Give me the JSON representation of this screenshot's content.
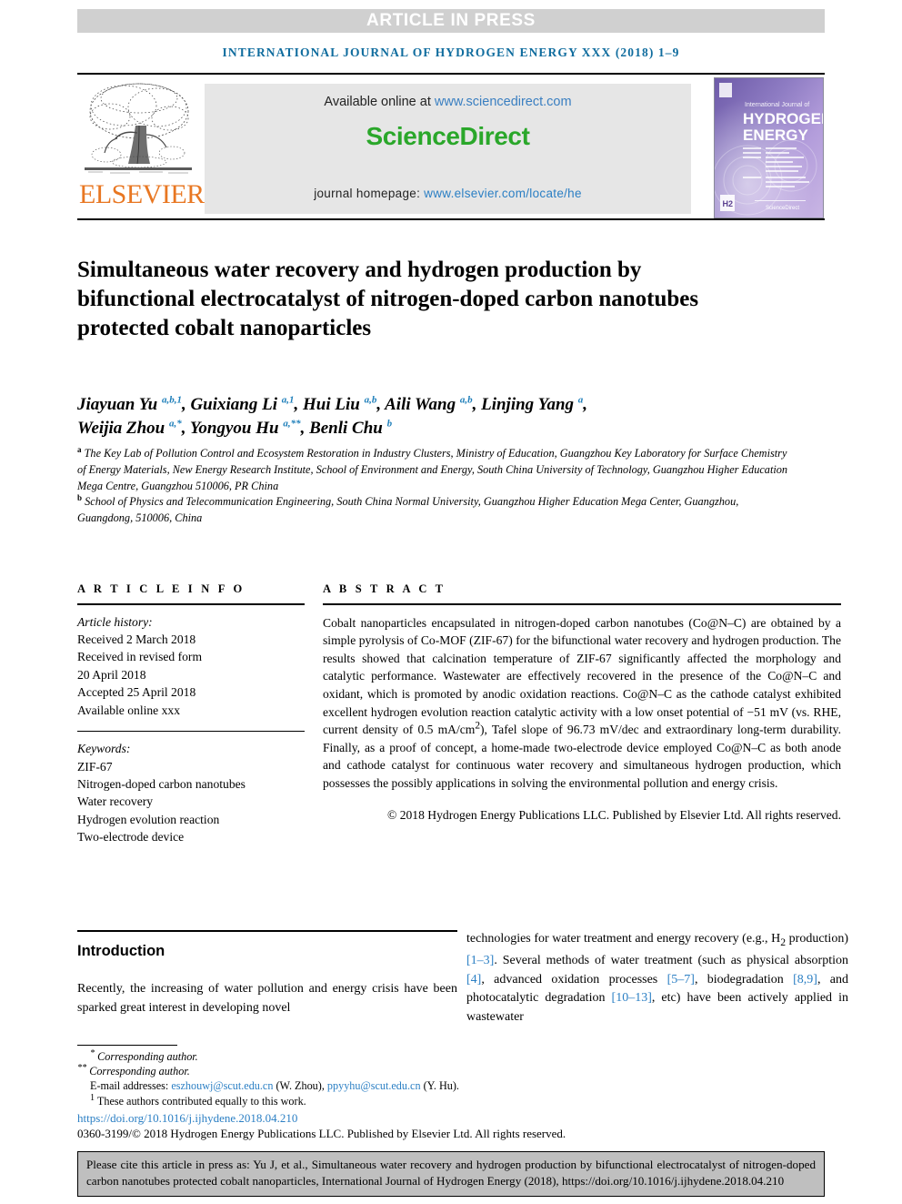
{
  "banner": {
    "text": "ARTICLE IN PRESS"
  },
  "running_head": {
    "text": "INTERNATIONAL JOURNAL OF HYDROGEN ENERGY XXX (2018) 1–9"
  },
  "masthead": {
    "publisher": "ELSEVIER",
    "available_prefix": "Available online at ",
    "available_url": "www.sciencedirect.com",
    "sciencedirect_logo": "ScienceDirect",
    "homepage_prefix": "journal homepage: ",
    "homepage_url": "www.elsevier.com/locate/he",
    "cover": {
      "kicker": "International Journal of",
      "line1": "HYDROGEN",
      "line2": "ENERGY",
      "footer": "ScienceDirect",
      "badge": "H2"
    }
  },
  "article": {
    "title": "Simultaneous water recovery and hydrogen production by bifunctional electrocatalyst of nitrogen-doped carbon nanotubes protected cobalt nanoparticles",
    "authors_line1_html": "Jiayuan Yu <sup>a,b,1</sup>, Guixiang Li <sup>a,1</sup>, Hui Liu <sup>a,b</sup>, Aili Wang <sup>a,b</sup>, Linjing Yang <sup>a</sup>,",
    "authors_line2_html": "Weijia Zhou <sup>a,*</sup>, Yongyou Hu <sup>a,**</sup>, Benli Chu <sup>b</sup>",
    "affiliation_a": "The Key Lab of Pollution Control and Ecosystem Restoration in Industry Clusters, Ministry of Education, Guangzhou Key Laboratory for Surface Chemistry of Energy Materials, New Energy Research Institute, School of Environment and Energy, South China University of Technology, Guangzhou Higher Education Mega Centre, Guangzhou 510006, PR China",
    "affiliation_b": "School of Physics and Telecommunication Engineering, South China Normal University, Guangzhou Higher Education Mega Center, Guangzhou, Guangdong, 510006, China"
  },
  "article_info": {
    "heading": "A R T I C L E   I N F O",
    "history_label": "Article history:",
    "history": [
      "Received 2 March 2018",
      "Received in revised form",
      "20 April 2018",
      "Accepted 25 April 2018",
      "Available online xxx"
    ],
    "keywords_label": "Keywords:",
    "keywords": [
      "ZIF-67",
      "Nitrogen-doped carbon nanotubes",
      "Water recovery",
      "Hydrogen evolution reaction",
      "Two-electrode device"
    ]
  },
  "abstract": {
    "heading": "A B S T R A C T",
    "body_html": "Cobalt nanoparticles encapsulated in nitrogen-doped carbon nanotubes (Co@N&ndash;C) are obtained by a simple pyrolysis of Co-MOF (ZIF-67) for the bifunctional water recovery and hydrogen production. The results showed that calcination temperature of ZIF-67 significantly affected the morphology and catalytic performance. Wastewater are effectively recovered in the presence of the Co@N&ndash;C and oxidant, which is promoted by anodic oxidation reactions. Co@N&ndash;C as the cathode catalyst exhibited excellent hydrogen evolution reaction catalytic activity with a low onset potential of &minus;51&nbsp;mV (vs. RHE, current density of 0.5&nbsp;mA/cm<sup>2</sup>), Tafel slope of 96.73&nbsp;mV/dec and extraordinary long-term durability. Finally, as a proof of concept, a home-made two-electrode device employed Co@N&ndash;C as both anode and cathode catalyst for continuous water recovery and simultaneous hydrogen production, which possesses the possibly applications in solving the environmental pollution and energy crisis.",
    "copyright": "© 2018 Hydrogen Energy Publications LLC. Published by Elsevier Ltd. All rights reserved."
  },
  "introduction": {
    "heading": "Introduction",
    "left_column_html": "Recently, the increasing of water pollution and energy crisis have been sparked great interest in developing novel",
    "right_column_html": "technologies for water treatment and energy recovery (e.g., H<sub>2</sub> production) <span class=\"ref\">[1&ndash;3]</span>. Several methods of water treatment (such as physical absorption <span class=\"ref\">[4]</span>, advanced oxidation processes <span class=\"ref\">[5&ndash;7]</span>, biodegradation <span class=\"ref\">[8,9]</span>, and photocatalytic degradation <span class=\"ref\">[10&ndash;13]</span>, etc) have been actively applied in wastewater"
  },
  "footnotes": {
    "corresponding_1": "Corresponding author.",
    "corresponding_2": "Corresponding author.",
    "email_label": "E-mail addresses:",
    "email_1": "eszhouwj@scut.edu.cn",
    "email_1_who": "(W. Zhou),",
    "email_2": "ppyyhu@scut.edu.cn",
    "email_2_who": "(Y. Hu).",
    "equal_contrib": "These authors contributed equally to this work.",
    "doi": "https://doi.org/10.1016/j.ijhydene.2018.04.210",
    "issn": "0360-3199/© 2018 Hydrogen Energy Publications LLC. Published by Elsevier Ltd. All rights reserved."
  },
  "cite_box": {
    "text": "Please cite this article in press as: Yu J, et al., Simultaneous water recovery and hydrogen production by bifunctional electrocatalyst of nitrogen-doped carbon nanotubes protected cobalt nanoparticles, International Journal of Hydrogen Energy (2018), https://doi.org/10.1016/j.ijhydene.2018.04.210"
  },
  "colors": {
    "link_blue": "#2b7fc4",
    "running_head_blue": "#0f6c9e",
    "elsevier_orange": "#e87722",
    "sciencedirect_green": "#2aa72a",
    "banner_gray": "#d0d0d0",
    "cite_box_gray": "#bfbfbf"
  }
}
